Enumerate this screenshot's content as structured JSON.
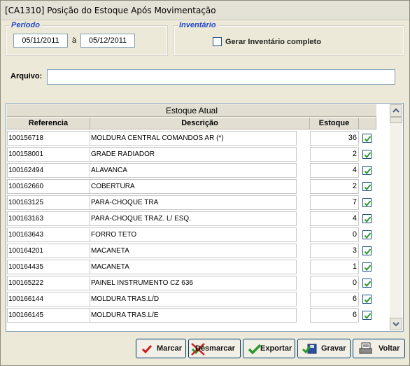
{
  "window": {
    "title": "[CA1310] Posição do Estoque Após Movimentação"
  },
  "periodo": {
    "label": "Período",
    "start": "05/11/2011",
    "separator": "à",
    "end": "05/12/2011"
  },
  "inventario": {
    "label": "Inventário",
    "checkbox_label": "Gerar Inventário completo",
    "checked": false
  },
  "arquivo": {
    "label": "Arquivo:",
    "value": ""
  },
  "grid": {
    "title": "Estoque Atual",
    "columns": [
      "Referencia",
      "Descrição",
      "Estoque"
    ],
    "rows": [
      {
        "referencia": "100156718",
        "descricao": "MOLDURA CENTRAL COMANDOS AR (*)",
        "estoque": "36",
        "checked": true
      },
      {
        "referencia": "100158001",
        "descricao": "GRADE RADIADOR",
        "estoque": "2",
        "checked": true
      },
      {
        "referencia": "100162494",
        "descricao": "ALAVANCA",
        "estoque": "4",
        "checked": true
      },
      {
        "referencia": "100162660",
        "descricao": "COBERTURA",
        "estoque": "2",
        "checked": true
      },
      {
        "referencia": "100163125",
        "descricao": "PARA-CHOQUE TRA",
        "estoque": "7",
        "checked": true
      },
      {
        "referencia": "100163163",
        "descricao": "PARA-CHOQUE TRAZ. L/ ESQ.",
        "estoque": "4",
        "checked": true
      },
      {
        "referencia": "100163643",
        "descricao": "FORRO TETO",
        "estoque": "0",
        "checked": true
      },
      {
        "referencia": "100164201",
        "descricao": "MACANETA",
        "estoque": "3",
        "checked": true
      },
      {
        "referencia": "100164435",
        "descricao": "MACANETA",
        "estoque": "1",
        "checked": true
      },
      {
        "referencia": "100165222",
        "descricao": "PAINEL INSTRUMENTO CZ 636",
        "estoque": "0",
        "checked": true
      },
      {
        "referencia": "100166144",
        "descricao": "MOLDURA TRAS.L/D",
        "estoque": "6",
        "checked": true
      },
      {
        "referencia": "100166145",
        "descricao": "MOLDURA TRAS.L/E",
        "estoque": "6",
        "checked": true
      }
    ]
  },
  "buttons": {
    "marcar": "Marcar",
    "desmarcar": "Desmarcar",
    "exportar": "Exportar",
    "gravar": "Gravar",
    "voltar": "Voltar"
  },
  "icons": {
    "marcar": "checkmark-red-icon",
    "desmarcar": "crossed-check-icon",
    "exportar": "checkmark-green-icon",
    "gravar": "save-disk-icon",
    "voltar": "back-printer-icon"
  },
  "colors": {
    "group_label": "#2149C8",
    "window_bg": "#ECE9D8",
    "check_green": "#2a9a2a"
  }
}
